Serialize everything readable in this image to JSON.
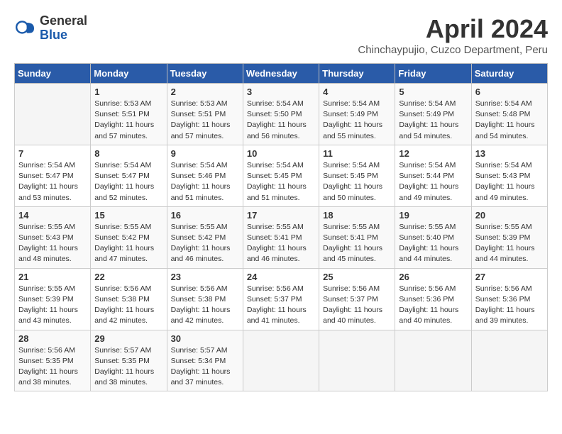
{
  "header": {
    "logo_general": "General",
    "logo_blue": "Blue",
    "title": "April 2024",
    "subtitle": "Chinchaypujio, Cuzco Department, Peru"
  },
  "days_of_week": [
    "Sunday",
    "Monday",
    "Tuesday",
    "Wednesday",
    "Thursday",
    "Friday",
    "Saturday"
  ],
  "weeks": [
    [
      null,
      {
        "day": 1,
        "sunrise": "5:53 AM",
        "sunset": "5:51 PM",
        "daylight": "11 hours and 57 minutes."
      },
      {
        "day": 2,
        "sunrise": "5:53 AM",
        "sunset": "5:51 PM",
        "daylight": "11 hours and 57 minutes."
      },
      {
        "day": 3,
        "sunrise": "5:54 AM",
        "sunset": "5:50 PM",
        "daylight": "11 hours and 56 minutes."
      },
      {
        "day": 4,
        "sunrise": "5:54 AM",
        "sunset": "5:49 PM",
        "daylight": "11 hours and 55 minutes."
      },
      {
        "day": 5,
        "sunrise": "5:54 AM",
        "sunset": "5:49 PM",
        "daylight": "11 hours and 54 minutes."
      },
      {
        "day": 6,
        "sunrise": "5:54 AM",
        "sunset": "5:48 PM",
        "daylight": "11 hours and 54 minutes."
      }
    ],
    [
      {
        "day": 7,
        "sunrise": "5:54 AM",
        "sunset": "5:47 PM",
        "daylight": "11 hours and 53 minutes."
      },
      {
        "day": 8,
        "sunrise": "5:54 AM",
        "sunset": "5:47 PM",
        "daylight": "11 hours and 52 minutes."
      },
      {
        "day": 9,
        "sunrise": "5:54 AM",
        "sunset": "5:46 PM",
        "daylight": "11 hours and 51 minutes."
      },
      {
        "day": 10,
        "sunrise": "5:54 AM",
        "sunset": "5:45 PM",
        "daylight": "11 hours and 51 minutes."
      },
      {
        "day": 11,
        "sunrise": "5:54 AM",
        "sunset": "5:45 PM",
        "daylight": "11 hours and 50 minutes."
      },
      {
        "day": 12,
        "sunrise": "5:54 AM",
        "sunset": "5:44 PM",
        "daylight": "11 hours and 49 minutes."
      },
      {
        "day": 13,
        "sunrise": "5:54 AM",
        "sunset": "5:43 PM",
        "daylight": "11 hours and 49 minutes."
      }
    ],
    [
      {
        "day": 14,
        "sunrise": "5:55 AM",
        "sunset": "5:43 PM",
        "daylight": "11 hours and 48 minutes."
      },
      {
        "day": 15,
        "sunrise": "5:55 AM",
        "sunset": "5:42 PM",
        "daylight": "11 hours and 47 minutes."
      },
      {
        "day": 16,
        "sunrise": "5:55 AM",
        "sunset": "5:42 PM",
        "daylight": "11 hours and 46 minutes."
      },
      {
        "day": 17,
        "sunrise": "5:55 AM",
        "sunset": "5:41 PM",
        "daylight": "11 hours and 46 minutes."
      },
      {
        "day": 18,
        "sunrise": "5:55 AM",
        "sunset": "5:41 PM",
        "daylight": "11 hours and 45 minutes."
      },
      {
        "day": 19,
        "sunrise": "5:55 AM",
        "sunset": "5:40 PM",
        "daylight": "11 hours and 44 minutes."
      },
      {
        "day": 20,
        "sunrise": "5:55 AM",
        "sunset": "5:39 PM",
        "daylight": "11 hours and 44 minutes."
      }
    ],
    [
      {
        "day": 21,
        "sunrise": "5:55 AM",
        "sunset": "5:39 PM",
        "daylight": "11 hours and 43 minutes."
      },
      {
        "day": 22,
        "sunrise": "5:56 AM",
        "sunset": "5:38 PM",
        "daylight": "11 hours and 42 minutes."
      },
      {
        "day": 23,
        "sunrise": "5:56 AM",
        "sunset": "5:38 PM",
        "daylight": "11 hours and 42 minutes."
      },
      {
        "day": 24,
        "sunrise": "5:56 AM",
        "sunset": "5:37 PM",
        "daylight": "11 hours and 41 minutes."
      },
      {
        "day": 25,
        "sunrise": "5:56 AM",
        "sunset": "5:37 PM",
        "daylight": "11 hours and 40 minutes."
      },
      {
        "day": 26,
        "sunrise": "5:56 AM",
        "sunset": "5:36 PM",
        "daylight": "11 hours and 40 minutes."
      },
      {
        "day": 27,
        "sunrise": "5:56 AM",
        "sunset": "5:36 PM",
        "daylight": "11 hours and 39 minutes."
      }
    ],
    [
      {
        "day": 28,
        "sunrise": "5:56 AM",
        "sunset": "5:35 PM",
        "daylight": "11 hours and 38 minutes."
      },
      {
        "day": 29,
        "sunrise": "5:57 AM",
        "sunset": "5:35 PM",
        "daylight": "11 hours and 38 minutes."
      },
      {
        "day": 30,
        "sunrise": "5:57 AM",
        "sunset": "5:34 PM",
        "daylight": "11 hours and 37 minutes."
      },
      null,
      null,
      null,
      null
    ]
  ]
}
